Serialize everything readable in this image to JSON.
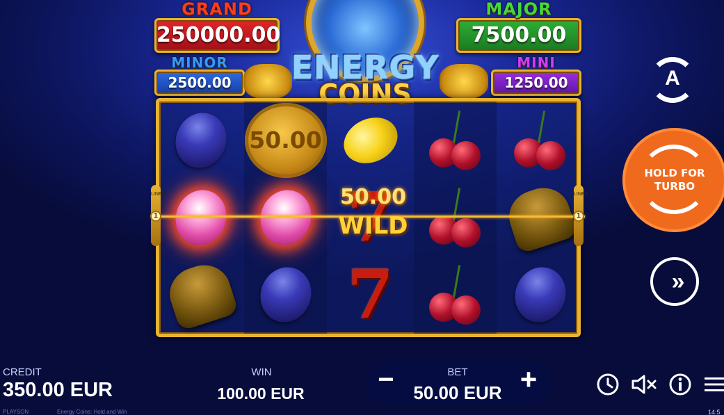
{
  "jackpots": {
    "grand": {
      "name": "GRAND",
      "value": "250000.00"
    },
    "major": {
      "name": "MAJOR",
      "value": "7500.00"
    },
    "minor": {
      "name": "MINOR",
      "value": "2500.00"
    },
    "mini": {
      "name": "MINI",
      "value": "1250.00"
    }
  },
  "logo": {
    "line1": "ENERGY",
    "line2": "COINS"
  },
  "reels": {
    "columns": [
      [
        "plum",
        "plum-glowing",
        "bell"
      ],
      [
        "coin",
        "plum-glowing",
        "plum"
      ],
      [
        "lemon",
        "seven-wild",
        "seven"
      ],
      [
        "cherry",
        "cherry",
        "cherry"
      ],
      [
        "cherry",
        "bell",
        "plum"
      ]
    ],
    "coin_value": "50.00",
    "wild_value": "50.00",
    "wild_label": "WILD",
    "line_number": "1",
    "lines_text": "LINES"
  },
  "controls": {
    "autoplay_letter": "A",
    "turbo_label": "HOLD FOR\nTURBO",
    "skip_glyph": "»"
  },
  "bottom_bar": {
    "credit_label": "CREDIT",
    "credit_value": "350.00 EUR",
    "win_label": "WIN",
    "win_value": "100.00 EUR",
    "bet_label": "BET",
    "bet_value": "50.00 EUR",
    "bet_minus": "−",
    "bet_plus": "+",
    "provider": "PLAYSON",
    "game_name": "Energy Coins: Hold and Win",
    "clock": "14:5"
  },
  "icons": [
    "history-icon",
    "sound-muted-icon",
    "info-icon",
    "menu-icon"
  ],
  "colors": {
    "accent_orange": "#f06a1e",
    "frame_gold": "#e8b432",
    "background": "#1b2a9c"
  }
}
